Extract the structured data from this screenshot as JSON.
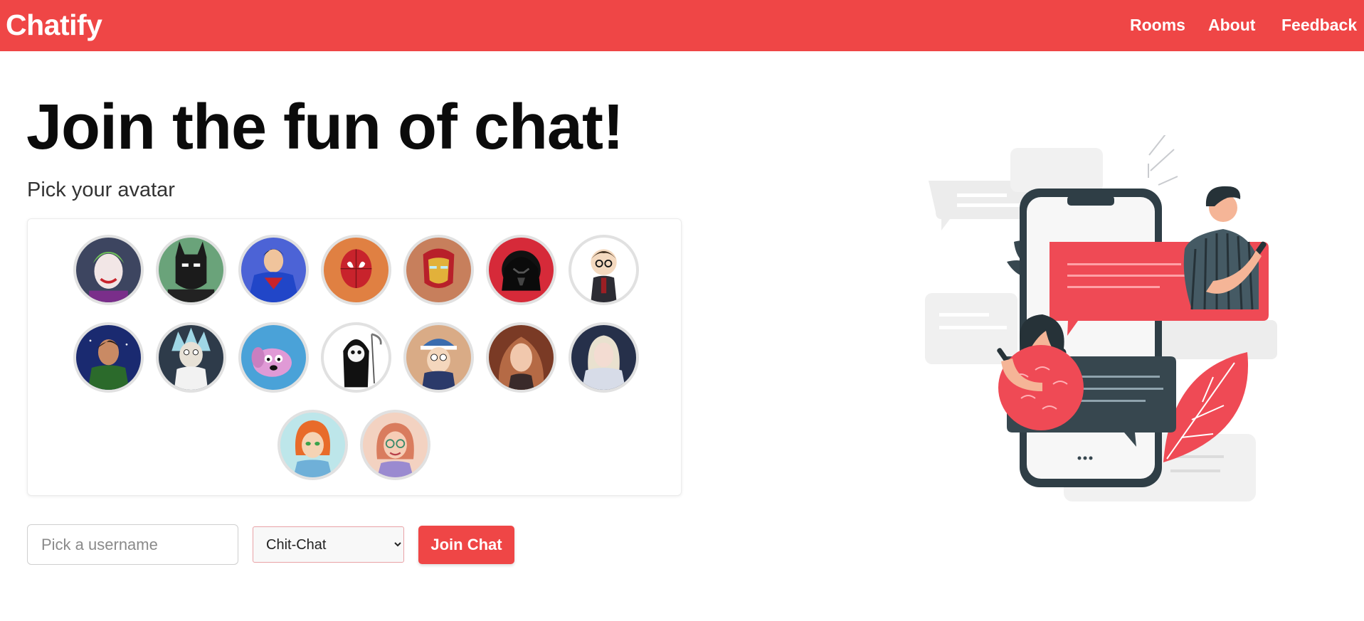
{
  "app": {
    "brand": "Chatify",
    "nav": [
      {
        "label": "Rooms"
      },
      {
        "label": "About"
      },
      {
        "label": "Feedback"
      }
    ],
    "accent_color": "#ef4646"
  },
  "hero": {
    "title": "Join the fun of chat!",
    "subtitle": "Pick your avatar"
  },
  "avatars": [
    {
      "name": "joker",
      "bg": "#3d4560",
      "fg": "#6fbf5a"
    },
    {
      "name": "batman",
      "bg": "#6aa37a",
      "fg": "#1b1b1b"
    },
    {
      "name": "superman",
      "bg": "#4c63d6",
      "fg": "#c8232c"
    },
    {
      "name": "spider-man",
      "bg": "#e08042",
      "fg": "#c8232c"
    },
    {
      "name": "iron-man",
      "bg": "#c77f5c",
      "fg": "#e2b13a"
    },
    {
      "name": "darth-vader",
      "bg": "#d62a39",
      "fg": "#0b0b0b"
    },
    {
      "name": "harry-potter",
      "bg": "#ffffff",
      "fg": "#3a2a1a"
    },
    {
      "name": "ben-10",
      "bg": "#1a2a70",
      "fg": "#2b6a2b"
    },
    {
      "name": "rick",
      "bg": "#2e3b4a",
      "fg": "#9fd7e6"
    },
    {
      "name": "courage",
      "bg": "#4aa2d8",
      "fg": "#e09ad6"
    },
    {
      "name": "grim",
      "bg": "#ffffff",
      "fg": "#111111"
    },
    {
      "name": "dipper",
      "bg": "#d9ab86",
      "fg": "#3b6cae"
    },
    {
      "name": "hermione",
      "bg": "#7a3a25",
      "fg": "#b56a45"
    },
    {
      "name": "girl-hoodie",
      "bg": "#26304a",
      "fg": "#d7dce8"
    },
    {
      "name": "gwen",
      "bg": "#bde6ea",
      "fg": "#e86b2a"
    },
    {
      "name": "girl-glasses",
      "bg": "#f3d2c1",
      "fg": "#d97c5e"
    }
  ],
  "form": {
    "username_placeholder": "Pick a username",
    "username_value": "",
    "room_selected": "Chit-Chat",
    "join_label": "Join Chat"
  }
}
